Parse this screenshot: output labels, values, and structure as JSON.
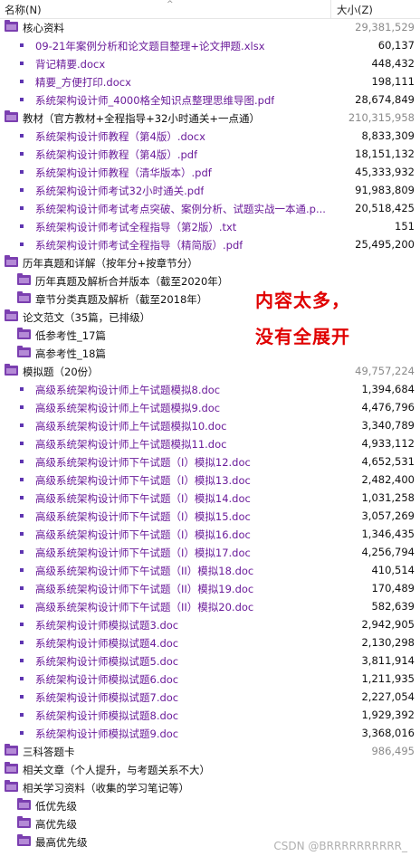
{
  "header": {
    "name_label": "名称(N)",
    "size_label": "大小(Z)",
    "sort_arrow": "^"
  },
  "rows": [
    {
      "type": "folder",
      "level": 0,
      "label": "核心资料",
      "size": "29,381,529"
    },
    {
      "type": "file",
      "level": 1,
      "label": "09-21年案例分析和论文题目整理+论文押题.xlsx",
      "size": "60,137"
    },
    {
      "type": "file",
      "level": 1,
      "label": "背记精要.docx",
      "size": "448,432"
    },
    {
      "type": "file",
      "level": 1,
      "label": "精要_方便打印.docx",
      "size": "198,111"
    },
    {
      "type": "file",
      "level": 1,
      "label": "系统架构设计师_4000格全知识点整理思维导图.pdf",
      "size": "28,674,849"
    },
    {
      "type": "folder",
      "level": 0,
      "label": "教材（官方教材+全程指导+32小时通关+一点通）",
      "size": "210,315,958"
    },
    {
      "type": "file",
      "level": 1,
      "label": "系统架构设计师教程（第4版）.docx",
      "size": "8,833,309"
    },
    {
      "type": "file",
      "level": 1,
      "label": "系统架构设计师教程（第4版）.pdf",
      "size": "18,151,132"
    },
    {
      "type": "file",
      "level": 1,
      "label": "系统架构设计师教程（清华版本）.pdf",
      "size": "45,333,932"
    },
    {
      "type": "file",
      "level": 1,
      "label": "系统架构设计师考试32小时通关.pdf",
      "size": "91,983,809"
    },
    {
      "type": "file",
      "level": 1,
      "label": "系统架构设计师考试考点突破、案例分析、试题实战一本通.p...",
      "size": "20,518,425"
    },
    {
      "type": "file",
      "level": 1,
      "label": "系统架构设计师考试全程指导（第2版）.txt",
      "size": "151"
    },
    {
      "type": "file",
      "level": 1,
      "label": "系统架构设计师考试全程指导（精简版）.pdf",
      "size": "25,495,200"
    },
    {
      "type": "folder",
      "level": 0,
      "label": "历年真题和详解（按年分+按章节分）",
      "size": ""
    },
    {
      "type": "folder",
      "level": 1,
      "label": "历年真题及解析合并版本（截至2020年）",
      "size": ""
    },
    {
      "type": "folder",
      "level": 1,
      "label": "章节分类真题及解析（截至2018年）",
      "size": ""
    },
    {
      "type": "folder",
      "level": 0,
      "label": "论文范文（35篇，已排级）",
      "size": ""
    },
    {
      "type": "folder",
      "level": 1,
      "label": "低参考性_17篇",
      "size": ""
    },
    {
      "type": "folder",
      "level": 1,
      "label": "高参考性_18篇",
      "size": ""
    },
    {
      "type": "folder",
      "level": 0,
      "label": "模拟题（20份）",
      "size": "49,757,224"
    },
    {
      "type": "file",
      "level": 1,
      "label": "高级系统架构设计师上午试题模拟8.doc",
      "size": "1,394,684"
    },
    {
      "type": "file",
      "level": 1,
      "label": "高级系统架构设计师上午试题模拟9.doc",
      "size": "4,476,796"
    },
    {
      "type": "file",
      "level": 1,
      "label": "高级系统架构设计师上午试题模拟10.doc",
      "size": "3,340,789"
    },
    {
      "type": "file",
      "level": 1,
      "label": "高级系统架构设计师上午试题模拟11.doc",
      "size": "4,933,112"
    },
    {
      "type": "file",
      "level": 1,
      "label": "高级系统架构设计师下午试题（I）模拟12.doc",
      "size": "4,652,531"
    },
    {
      "type": "file",
      "level": 1,
      "label": "高级系统架构设计师下午试题（I）模拟13.doc",
      "size": "2,482,400"
    },
    {
      "type": "file",
      "level": 1,
      "label": "高级系统架构设计师下午试题（I）模拟14.doc",
      "size": "1,031,258"
    },
    {
      "type": "file",
      "level": 1,
      "label": "高级系统架构设计师下午试题（I）模拟15.doc",
      "size": "3,057,269"
    },
    {
      "type": "file",
      "level": 1,
      "label": "高级系统架构设计师下午试题（I）模拟16.doc",
      "size": "1,346,435"
    },
    {
      "type": "file",
      "level": 1,
      "label": "高级系统架构设计师下午试题（I）模拟17.doc",
      "size": "4,256,794"
    },
    {
      "type": "file",
      "level": 1,
      "label": "高级系统架构设计师下午试题（II）模拟18.doc",
      "size": "410,514"
    },
    {
      "type": "file",
      "level": 1,
      "label": "高级系统架构设计师下午试题（II）模拟19.doc",
      "size": "170,489"
    },
    {
      "type": "file",
      "level": 1,
      "label": "高级系统架构设计师下午试题（II）模拟20.doc",
      "size": "582,639"
    },
    {
      "type": "file",
      "level": 1,
      "label": "系统架构设计师模拟试题3.doc",
      "size": "2,942,905"
    },
    {
      "type": "file",
      "level": 1,
      "label": "系统架构设计师模拟试题4.doc",
      "size": "2,130,298"
    },
    {
      "type": "file",
      "level": 1,
      "label": "系统架构设计师模拟试题5.doc",
      "size": "3,811,914"
    },
    {
      "type": "file",
      "level": 1,
      "label": "系统架构设计师模拟试题6.doc",
      "size": "1,211,935"
    },
    {
      "type": "file",
      "level": 1,
      "label": "系统架构设计师模拟试题7.doc",
      "size": "2,227,054"
    },
    {
      "type": "file",
      "level": 1,
      "label": "系统架构设计师模拟试题8.doc",
      "size": "1,929,392"
    },
    {
      "type": "file",
      "level": 1,
      "label": "系统架构设计师模拟试题9.doc",
      "size": "3,368,016"
    },
    {
      "type": "folder",
      "level": 0,
      "label": "三科答题卡",
      "size": "986,495"
    },
    {
      "type": "folder",
      "level": 0,
      "label": "相关文章（个人提升，与考题关系不大）",
      "size": ""
    },
    {
      "type": "folder",
      "level": 0,
      "label": "相关学习资料（收集的学习笔记等）",
      "size": ""
    },
    {
      "type": "folder",
      "level": 1,
      "label": "低优先级",
      "size": ""
    },
    {
      "type": "folder",
      "level": 1,
      "label": "高优先级",
      "size": ""
    },
    {
      "type": "folder",
      "level": 1,
      "label": "最高优先级",
      "size": ""
    }
  ],
  "overlay": {
    "line1": "内容太多，",
    "line2": "没有全展开"
  },
  "watermark": "CSDN @BRRRRRRRRRR_",
  "colors": {
    "file_text": "#6a1b9a",
    "folder_icon": "#7b3fb0",
    "overlay": "#e00000"
  }
}
